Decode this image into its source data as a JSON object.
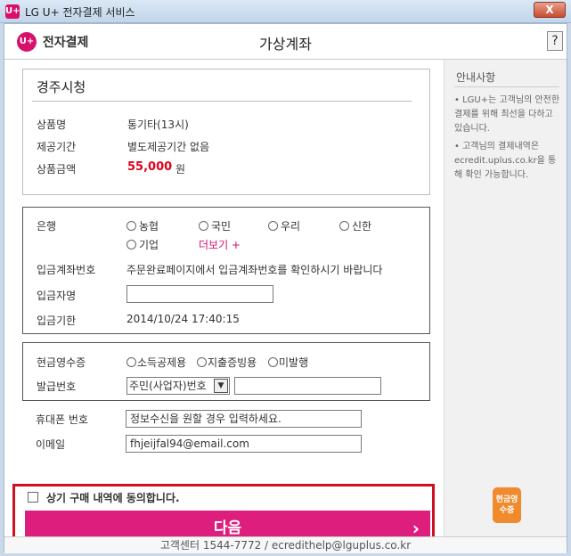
{
  "window": {
    "logo_text": "U+",
    "title": "LG U+ 전자결제 서비스",
    "close_label": "X"
  },
  "header": {
    "brand_icon": "U+",
    "brand_text": "전자결제",
    "page_title": "가상계좌",
    "help_label": "?"
  },
  "merchant": {
    "name": "경주시청",
    "rows": [
      {
        "label": "상품명",
        "value": "통기타(13시)"
      },
      {
        "label": "제공기간",
        "value": "별도제공기간 없음"
      },
      {
        "label": "상품금액",
        "value": "55,000",
        "unit": "원"
      }
    ],
    "amount_color": "#e2001a"
  },
  "bank": {
    "label": "은행",
    "options": [
      "농협",
      "국민",
      "우리",
      "신한",
      "기업"
    ],
    "more_label": "더보기 +",
    "more_color": "#d8106b",
    "account_label": "입금계좌번호",
    "account_text": "주문완료페이지에서 입금계좌번호를 확인하시기 바랍니다",
    "depositor_label": "입금자명",
    "depositor_value": "",
    "deadline_label": "입금기한",
    "deadline_value": "2014/10/24 17:40:15"
  },
  "receipt": {
    "label": "현금영수증",
    "options": [
      "소득공제용",
      "지출증빙용",
      "미발행"
    ],
    "number_label": "발급번호",
    "number_type": "주민(사업자)번호",
    "number_value": ""
  },
  "contact": {
    "phone_label": "휴대폰 번호",
    "phone_value": "정보수신을 원할 경우 입력하세요.",
    "email_label": "이메일",
    "email_value": "fhjeijfal94@email.com"
  },
  "agree": {
    "text": "상기 구매 내역에 동의합니다.",
    "next_label": "다음",
    "next_arrow": "›",
    "highlight_color": "#d0101f"
  },
  "side": {
    "title": "안내사항",
    "notes": [
      "• LGU+는 고객님의 안전한 결제를 위해 최선을 다하고 있습니다.",
      "• 고객님의 결제내역은 ecredit.uplus.co.kr을 통해 확인 가능합니다."
    ],
    "badge_text": "현금영수증"
  },
  "footer": {
    "text": "고객센터 1544-7772 / ecredithelp@lguplus.co.kr"
  }
}
